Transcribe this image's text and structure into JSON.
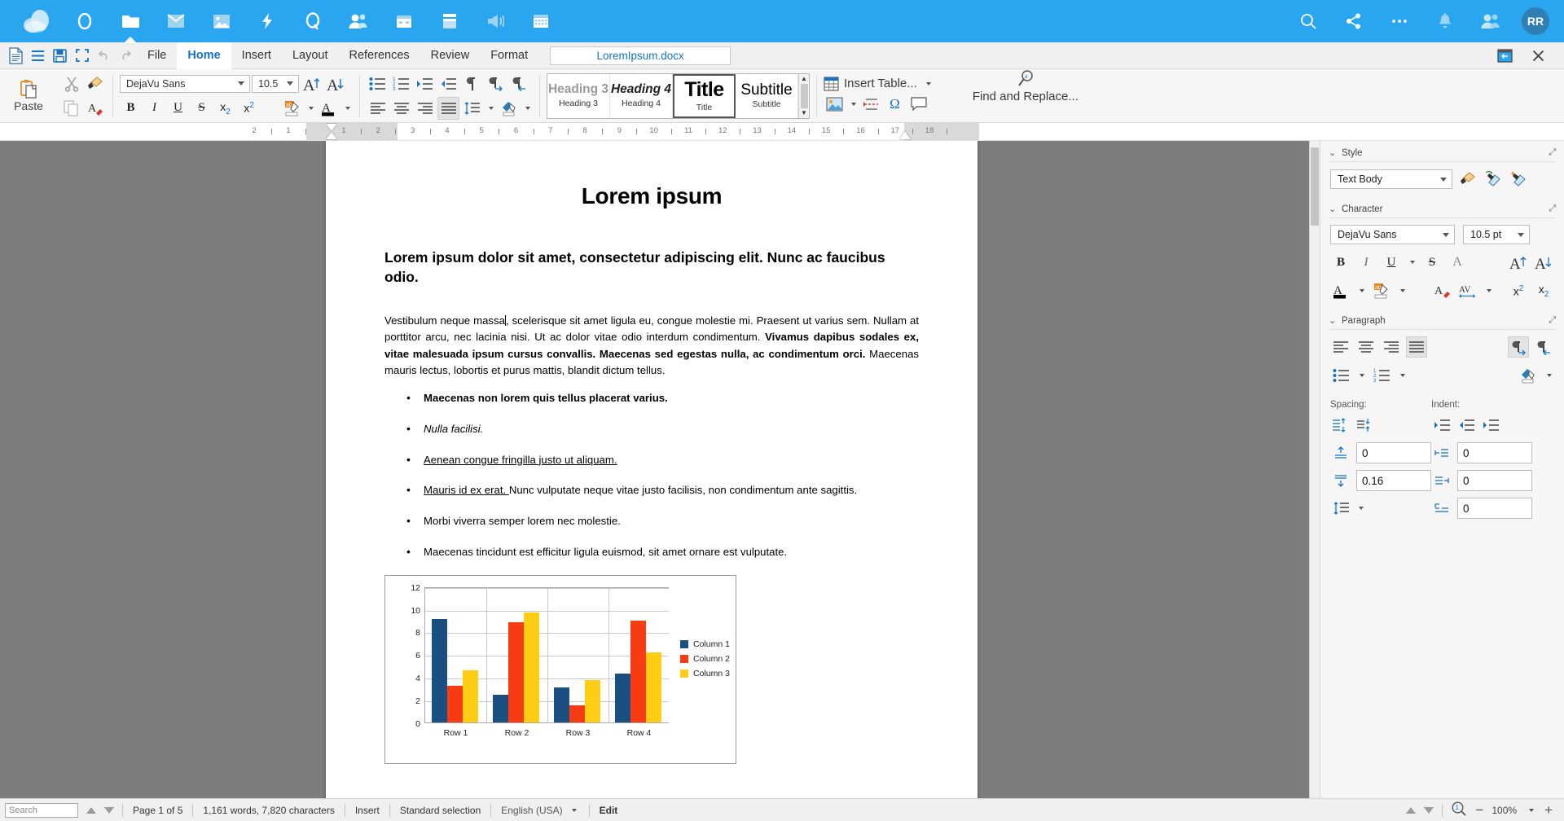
{
  "cloudbar": {
    "logo": "cloud-logo",
    "icons": [
      {
        "name": "circle-icon",
        "glyph": "circle"
      },
      {
        "name": "files-icon",
        "glyph": "folder",
        "active": true
      },
      {
        "name": "mail-icon",
        "glyph": "mail"
      },
      {
        "name": "photos-icon",
        "glyph": "photo"
      },
      {
        "name": "activity-icon",
        "glyph": "bolt"
      },
      {
        "name": "search-app-icon",
        "glyph": "q"
      },
      {
        "name": "contacts-icon",
        "glyph": "people"
      },
      {
        "name": "calendar-app-icon",
        "glyph": "calendar-days"
      },
      {
        "name": "deck-icon",
        "glyph": "deck"
      },
      {
        "name": "announcements-icon",
        "glyph": "megaphone"
      },
      {
        "name": "calendar-icon",
        "glyph": "calendar-grid"
      }
    ],
    "right_icons": [
      {
        "name": "search-icon",
        "glyph": "search"
      },
      {
        "name": "share-icon",
        "glyph": "share"
      },
      {
        "name": "more-icon",
        "glyph": "dots"
      },
      {
        "name": "notifications-icon",
        "glyph": "bell"
      },
      {
        "name": "contacts-menu-icon",
        "glyph": "people"
      }
    ],
    "avatar_initials": "RR",
    "avatar_color": "#2f7fb5",
    "background": "#2aa5ef"
  },
  "menubar": {
    "icons": [
      {
        "name": "document-icon"
      },
      {
        "name": "menu-icon"
      },
      {
        "name": "save-icon"
      },
      {
        "name": "fullscreen-icon"
      },
      {
        "name": "undo-icon"
      },
      {
        "name": "redo-icon"
      }
    ],
    "items": [
      {
        "label": "File",
        "selected": false
      },
      {
        "label": "Home",
        "selected": true
      },
      {
        "label": "Insert",
        "selected": false
      },
      {
        "label": "Layout",
        "selected": false
      },
      {
        "label": "References",
        "selected": false
      },
      {
        "label": "Review",
        "selected": false
      },
      {
        "label": "Format",
        "selected": false
      }
    ],
    "document_tab": "LoremIpsum.docx",
    "right_icons": [
      {
        "name": "restore-window-icon"
      },
      {
        "name": "close-icon",
        "glyph": "✕"
      }
    ]
  },
  "ribbon": {
    "paste_label": "Paste",
    "font_name": "DejaVu Sans",
    "font_size": "10.5",
    "tools": {
      "cut": "cut-icon",
      "copy": "copy-icon",
      "clone_formatting": "clone-formatting-icon",
      "clear_formatting": "clear-formatting-icon",
      "bold": "B",
      "italic": "I",
      "underline": "U",
      "strikethrough": "S",
      "subscript": "x₂",
      "superscript": "x²",
      "increase_font": "increase-font-size-icon",
      "decrease_font": "decrease-font-size-icon",
      "highlight": "highlight-color-icon",
      "font_color": "font-color-icon",
      "unordered_list": "unordered-list-icon",
      "ordered_list": "ordered-list-icon",
      "increase_indent": "increase-indent-icon",
      "decrease_indent": "decrease-indent-icon",
      "formatting_marks": "formatting-marks-icon",
      "ltr": "left-to-right-icon",
      "rtl": "right-to-left-icon",
      "align_left": "align-left-icon",
      "align_center": "align-center-icon",
      "align_right": "align-right-icon",
      "align_justified": "align-justified-icon",
      "line_spacing": "line-spacing-icon",
      "paragraph_background": "paragraph-background-icon"
    },
    "gallery": [
      {
        "display": "Heading 3",
        "name": "Heading 3",
        "style": "h3"
      },
      {
        "display": "Heading 4",
        "name": "Heading 4",
        "style": "h4"
      },
      {
        "display": "Title",
        "name": "Title",
        "style": "title",
        "selected": true
      },
      {
        "display": "Subtitle",
        "name": "Subtitle",
        "style": "subtitle"
      }
    ],
    "insert_table_label": "Insert Table...",
    "insert_icons": [
      {
        "name": "insert-image-icon"
      },
      {
        "name": "insert-page-break-icon"
      },
      {
        "name": "insert-special-character-icon"
      },
      {
        "name": "insert-comment-icon"
      }
    ],
    "find_replace_label": "Find and Replace..."
  },
  "ruler": {
    "left_labels": [
      "2",
      "1"
    ],
    "labels": [
      "1",
      "2",
      "3",
      "4",
      "5",
      "6",
      "7",
      "8",
      "9",
      "10",
      "11",
      "12",
      "13",
      "14",
      "15",
      "16",
      "17",
      "18"
    ]
  },
  "document": {
    "title": "Lorem ipsum",
    "heading": "Lorem ipsum dolor sit amet, consectetur adipiscing elit. Nunc ac faucibus odio.",
    "paragraph": {
      "part1": "Vestibulum neque massa",
      "part2": ", scelerisque sit amet ligula eu, congue molestie mi. Praesent ut varius sem. Nullam at porttitor arcu, nec lacinia nisi. Ut ac dolor vitae odio interdum condimentum. ",
      "bold": "Vivamus dapibus sodales ex, vitae malesuada ipsum cursus convallis. Maecenas sed egestas nulla, ac condimentum orci.",
      "part3": " Maecenas mauris lectus, lobortis et purus mattis, blandit dictum tellus."
    },
    "bullets": [
      {
        "text": "Maecenas non lorem quis tellus placerat varius.",
        "style": "bold"
      },
      {
        "text": "Nulla facilisi.",
        "style": "italic"
      },
      {
        "text": "Aenean congue fringilla justo ut aliquam. ",
        "style": "underline"
      },
      {
        "text": "Mauris id ex erat. ",
        "style": "underline",
        "rest": "Nunc vulputate neque vitae justo facilisis, non condimentum ante sagittis."
      },
      {
        "text": "Morbi viverra semper lorem nec molestie.",
        "style": "normal"
      },
      {
        "text": "Maecenas tincidunt est efficitur ligula euismod, sit amet ornare est vulputate.",
        "style": "normal"
      }
    ]
  },
  "chart_data": {
    "type": "bar",
    "title": "",
    "xlabel": "",
    "ylabel": "",
    "categories": [
      "Row 1",
      "Row 2",
      "Row 3",
      "Row 4"
    ],
    "series": [
      {
        "name": "Column 1",
        "color": "#1a4f82",
        "values": [
          9.1,
          2.4,
          3.1,
          4.3
        ]
      },
      {
        "name": "Column 2",
        "color": "#f93b14",
        "values": [
          3.2,
          8.8,
          1.5,
          9.0
        ]
      },
      {
        "name": "Column 3",
        "color": "#ffcd14",
        "values": [
          4.55,
          9.7,
          3.75,
          6.2
        ]
      }
    ],
    "ylim": [
      0,
      12
    ],
    "yticks": [
      0,
      2,
      4,
      6,
      8,
      10,
      12
    ],
    "grid": true,
    "legend_position": "right"
  },
  "sidebar": {
    "sections": [
      {
        "title": "Style"
      },
      {
        "title": "Character"
      },
      {
        "title": "Paragraph"
      }
    ],
    "style_value": "Text Body",
    "style_icons": [
      {
        "name": "clone-formatting-icon"
      },
      {
        "name": "update-selected-style-icon"
      },
      {
        "name": "new-style-from-selection-icon"
      }
    ],
    "char_font": "DejaVu Sans",
    "char_size": "10.5 pt",
    "char_icons": [
      {
        "name": "bold-icon",
        "glyph": "B"
      },
      {
        "name": "italic-icon",
        "glyph": "I"
      },
      {
        "name": "underline-icon",
        "glyph": "U"
      },
      {
        "name": "strikethrough-icon",
        "glyph": "S"
      },
      {
        "name": "shadow-icon",
        "glyph": "A"
      },
      {
        "name": "increase-font-size-icon"
      },
      {
        "name": "decrease-font-size-icon"
      },
      {
        "name": "font-color-icon"
      },
      {
        "name": "highlight-color-icon"
      },
      {
        "name": "clear-formatting-icon"
      },
      {
        "name": "character-spacing-icon"
      },
      {
        "name": "superscript-icon",
        "glyph": "x²"
      },
      {
        "name": "subscript-icon",
        "glyph": "x₂"
      }
    ],
    "spacing_label": "Spacing:",
    "indent_label": "Indent:",
    "spacing_above": "0",
    "spacing_below": "0.16",
    "indent_before": "0",
    "indent_after": "0",
    "indent_first_line": "0"
  },
  "statusbar": {
    "search_placeholder": "Search",
    "page": "Page 1 of 5",
    "words": "1,161 words, 7,820 characters",
    "mode": "Insert",
    "selection": "Standard selection",
    "language": "English (USA)",
    "edit": "Edit",
    "zoom": "100%"
  }
}
